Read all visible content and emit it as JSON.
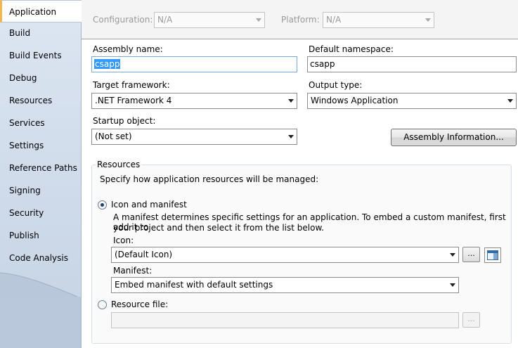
{
  "tabs": [
    {
      "label": "Application",
      "active": true
    },
    {
      "label": "Build"
    },
    {
      "label": "Build Events"
    },
    {
      "label": "Debug"
    },
    {
      "label": "Resources"
    },
    {
      "label": "Services"
    },
    {
      "label": "Settings"
    },
    {
      "label": "Reference Paths"
    },
    {
      "label": "Signing"
    },
    {
      "label": "Security"
    },
    {
      "label": "Publish"
    },
    {
      "label": "Code Analysis"
    }
  ],
  "topbar": {
    "configuration_label": "Configuration:",
    "configuration_value": "N/A",
    "platform_label": "Platform:",
    "platform_value": "N/A"
  },
  "form": {
    "assembly_name_label": "Assembly name:",
    "assembly_name_value": "csapp",
    "default_namespace_label": "Default namespace:",
    "default_namespace_value": "csapp",
    "target_framework_label": "Target framework:",
    "target_framework_value": ".NET Framework 4",
    "output_type_label": "Output type:",
    "output_type_value": "Windows Application",
    "startup_object_label": "Startup object:",
    "startup_object_value": "(Not set)",
    "assembly_info_button": "Assembly Information..."
  },
  "resources": {
    "group_title": "Resources",
    "intro": "Specify how application resources will be managed:",
    "icon_manifest_label": "Icon and manifest",
    "icon_manifest_checked": true,
    "description_line1": "A manifest determines specific settings for an application. To embed a custom manifest, first add it to",
    "description_line2": "your project and then select it from the list below.",
    "icon_label": "Icon:",
    "icon_value": "(Default Icon)",
    "manifest_label": "Manifest:",
    "manifest_value": "Embed manifest with default settings",
    "resource_file_label": "Resource file:",
    "resource_file_checked": false,
    "resource_file_value": "",
    "browse_label": "..."
  },
  "colors": {
    "selection": "#3399ff",
    "active_tab_accent": "#f4b54a",
    "tab_strip": "#d3deec"
  }
}
